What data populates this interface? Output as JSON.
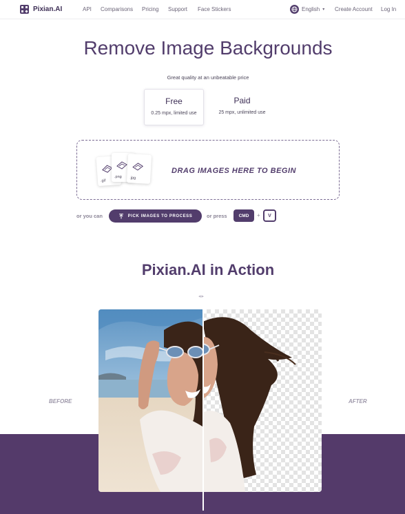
{
  "nav": {
    "brand": "Pixian.AI",
    "links": [
      "API",
      "Comparisons",
      "Pricing",
      "Support",
      "Face Stickers"
    ],
    "language": "English",
    "language_caret": "▾",
    "create_account": "Create Account",
    "login": "Log In"
  },
  "hero": {
    "title": "Remove Image Backgrounds",
    "subtitle": "Great quality at an unbeatable price"
  },
  "plans": [
    {
      "name": "Free",
      "desc": "0.25 mpx, limited use",
      "selected": true
    },
    {
      "name": "Paid",
      "desc": "25 mpx, unlimited use",
      "selected": false
    }
  ],
  "dropzone": {
    "text": "DRAG IMAGES HERE TO BEGIN",
    "file_types": [
      ".gif",
      ".png",
      ".jpg"
    ]
  },
  "actions": {
    "or_you_can": "or you can",
    "pick_button": "PICK IMAGES TO PROCESS",
    "or_press": "or press",
    "key_cmd": "CMD",
    "plus": "+",
    "key_v": "V"
  },
  "showcase": {
    "title": "Pixian.AI in Action",
    "slider_arrows": "◂▸",
    "before_label": "BEFORE",
    "after_label": "AFTER"
  },
  "colors": {
    "brand": "#523d6c",
    "band": "#543a6a"
  },
  "icons": [
    "logo-grid-icon",
    "globe-icon",
    "upload-icon",
    "image-file-icon"
  ]
}
